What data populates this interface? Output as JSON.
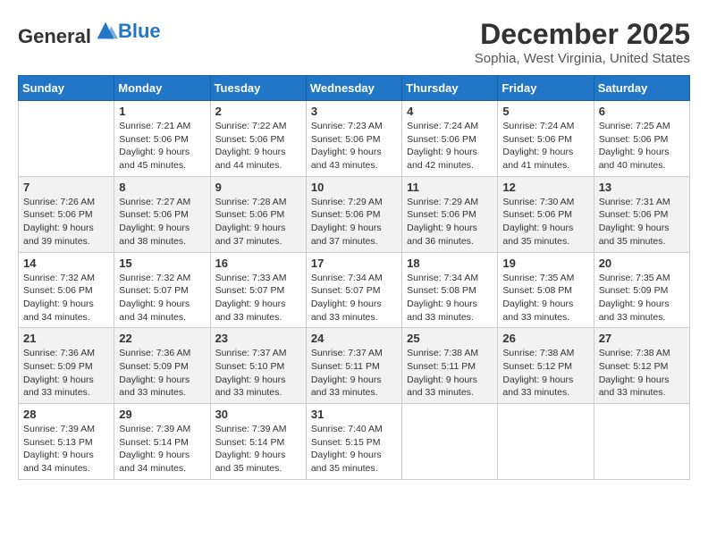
{
  "header": {
    "logo": {
      "general": "General",
      "blue": "Blue"
    },
    "title": "December 2025",
    "location": "Sophia, West Virginia, United States"
  },
  "days_of_week": [
    "Sunday",
    "Monday",
    "Tuesday",
    "Wednesday",
    "Thursday",
    "Friday",
    "Saturday"
  ],
  "weeks": [
    [
      {
        "day": "",
        "detail": ""
      },
      {
        "day": "1",
        "detail": "Sunrise: 7:21 AM\nSunset: 5:06 PM\nDaylight: 9 hours\nand 45 minutes."
      },
      {
        "day": "2",
        "detail": "Sunrise: 7:22 AM\nSunset: 5:06 PM\nDaylight: 9 hours\nand 44 minutes."
      },
      {
        "day": "3",
        "detail": "Sunrise: 7:23 AM\nSunset: 5:06 PM\nDaylight: 9 hours\nand 43 minutes."
      },
      {
        "day": "4",
        "detail": "Sunrise: 7:24 AM\nSunset: 5:06 PM\nDaylight: 9 hours\nand 42 minutes."
      },
      {
        "day": "5",
        "detail": "Sunrise: 7:24 AM\nSunset: 5:06 PM\nDaylight: 9 hours\nand 41 minutes."
      },
      {
        "day": "6",
        "detail": "Sunrise: 7:25 AM\nSunset: 5:06 PM\nDaylight: 9 hours\nand 40 minutes."
      }
    ],
    [
      {
        "day": "7",
        "detail": "Sunrise: 7:26 AM\nSunset: 5:06 PM\nDaylight: 9 hours\nand 39 minutes."
      },
      {
        "day": "8",
        "detail": "Sunrise: 7:27 AM\nSunset: 5:06 PM\nDaylight: 9 hours\nand 38 minutes."
      },
      {
        "day": "9",
        "detail": "Sunrise: 7:28 AM\nSunset: 5:06 PM\nDaylight: 9 hours\nand 37 minutes."
      },
      {
        "day": "10",
        "detail": "Sunrise: 7:29 AM\nSunset: 5:06 PM\nDaylight: 9 hours\nand 37 minutes."
      },
      {
        "day": "11",
        "detail": "Sunrise: 7:29 AM\nSunset: 5:06 PM\nDaylight: 9 hours\nand 36 minutes."
      },
      {
        "day": "12",
        "detail": "Sunrise: 7:30 AM\nSunset: 5:06 PM\nDaylight: 9 hours\nand 35 minutes."
      },
      {
        "day": "13",
        "detail": "Sunrise: 7:31 AM\nSunset: 5:06 PM\nDaylight: 9 hours\nand 35 minutes."
      }
    ],
    [
      {
        "day": "14",
        "detail": "Sunrise: 7:32 AM\nSunset: 5:06 PM\nDaylight: 9 hours\nand 34 minutes."
      },
      {
        "day": "15",
        "detail": "Sunrise: 7:32 AM\nSunset: 5:07 PM\nDaylight: 9 hours\nand 34 minutes."
      },
      {
        "day": "16",
        "detail": "Sunrise: 7:33 AM\nSunset: 5:07 PM\nDaylight: 9 hours\nand 33 minutes."
      },
      {
        "day": "17",
        "detail": "Sunrise: 7:34 AM\nSunset: 5:07 PM\nDaylight: 9 hours\nand 33 minutes."
      },
      {
        "day": "18",
        "detail": "Sunrise: 7:34 AM\nSunset: 5:08 PM\nDaylight: 9 hours\nand 33 minutes."
      },
      {
        "day": "19",
        "detail": "Sunrise: 7:35 AM\nSunset: 5:08 PM\nDaylight: 9 hours\nand 33 minutes."
      },
      {
        "day": "20",
        "detail": "Sunrise: 7:35 AM\nSunset: 5:09 PM\nDaylight: 9 hours\nand 33 minutes."
      }
    ],
    [
      {
        "day": "21",
        "detail": "Sunrise: 7:36 AM\nSunset: 5:09 PM\nDaylight: 9 hours\nand 33 minutes."
      },
      {
        "day": "22",
        "detail": "Sunrise: 7:36 AM\nSunset: 5:09 PM\nDaylight: 9 hours\nand 33 minutes."
      },
      {
        "day": "23",
        "detail": "Sunrise: 7:37 AM\nSunset: 5:10 PM\nDaylight: 9 hours\nand 33 minutes."
      },
      {
        "day": "24",
        "detail": "Sunrise: 7:37 AM\nSunset: 5:11 PM\nDaylight: 9 hours\nand 33 minutes."
      },
      {
        "day": "25",
        "detail": "Sunrise: 7:38 AM\nSunset: 5:11 PM\nDaylight: 9 hours\nand 33 minutes."
      },
      {
        "day": "26",
        "detail": "Sunrise: 7:38 AM\nSunset: 5:12 PM\nDaylight: 9 hours\nand 33 minutes."
      },
      {
        "day": "27",
        "detail": "Sunrise: 7:38 AM\nSunset: 5:12 PM\nDaylight: 9 hours\nand 33 minutes."
      }
    ],
    [
      {
        "day": "28",
        "detail": "Sunrise: 7:39 AM\nSunset: 5:13 PM\nDaylight: 9 hours\nand 34 minutes."
      },
      {
        "day": "29",
        "detail": "Sunrise: 7:39 AM\nSunset: 5:14 PM\nDaylight: 9 hours\nand 34 minutes."
      },
      {
        "day": "30",
        "detail": "Sunrise: 7:39 AM\nSunset: 5:14 PM\nDaylight: 9 hours\nand 35 minutes."
      },
      {
        "day": "31",
        "detail": "Sunrise: 7:40 AM\nSunset: 5:15 PM\nDaylight: 9 hours\nand 35 minutes."
      },
      {
        "day": "",
        "detail": ""
      },
      {
        "day": "",
        "detail": ""
      },
      {
        "day": "",
        "detail": ""
      }
    ]
  ]
}
